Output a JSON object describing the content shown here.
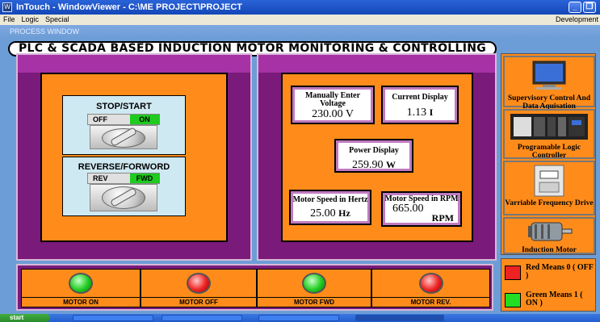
{
  "window": {
    "title": "InTouch - WindowViewer - C:\\ME PROJECT\\PROJECT",
    "app_icon": "intouch-app-icon"
  },
  "menu": {
    "items": [
      "File",
      "Logic",
      "Special"
    ],
    "mode": "Development"
  },
  "process_window_label": "PROCESS WINDOW",
  "main_title": "PLC & SCADA BASED INDUCTION MOTOR MONITORING & CONTROLLING",
  "switches": {
    "stop_start": {
      "title": "STOP/START",
      "off": "OFF",
      "on": "ON"
    },
    "reverse_forward": {
      "title": "REVERSE/FORWORD",
      "rev": "REV",
      "fwd": "FWD"
    }
  },
  "displays": {
    "voltage": {
      "caption": "Manually Enter Voltage",
      "value": "230.00",
      "unit": "V"
    },
    "current": {
      "caption": "Current Display",
      "value": "1.13",
      "unit": "I"
    },
    "power": {
      "caption": "Power Display",
      "value": "259.90",
      "unit": "W"
    },
    "speed_hz": {
      "caption": "Motor Speed in Hertz",
      "value": "25.00",
      "unit": "Hz"
    },
    "speed_rpm": {
      "caption": "Motor Speed in RPM",
      "value": "665.00",
      "unit": "RPM"
    }
  },
  "right_panel": [
    {
      "label": "Supervisory Control And Data Aquisation",
      "icon": "monitor-icon"
    },
    {
      "label": "Programable Logic Controller",
      "icon": "plc-rack-icon"
    },
    {
      "label": "Varriable Frequency Drive",
      "icon": "vfd-drive-icon"
    },
    {
      "label": "Induction Motor",
      "icon": "motor-icon"
    }
  ],
  "legend": {
    "red": {
      "text": "Red Means 0 ( OFF )",
      "color": "#ee2222"
    },
    "green": {
      "text": "Green Means 1 ( ON )",
      "color": "#22dd22"
    }
  },
  "buttons": [
    {
      "label": "MOTOR ON",
      "led": "green"
    },
    {
      "label": "MOTOR OFF",
      "led": "red"
    },
    {
      "label": "MOTOR FWD",
      "led": "green"
    },
    {
      "label": "MOTOR REV.",
      "led": "red"
    }
  ],
  "taskbar": {
    "start": "start"
  }
}
